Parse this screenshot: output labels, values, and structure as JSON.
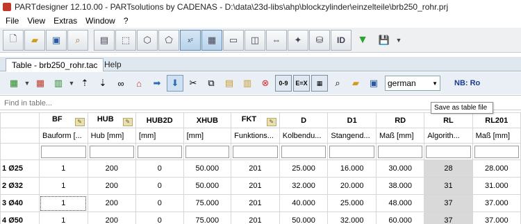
{
  "window": {
    "title": "PARTdesigner 12.10.00 - PARTsolutions by CADENAS - D:\\data\\23d-libs\\ahp\\blockzylinder\\einzelteile\\brb250_rohr.prj"
  },
  "menu": {
    "items": [
      "File",
      "View",
      "Extras",
      "Window",
      "?"
    ]
  },
  "toolbar1": {
    "icons": [
      "new-document-icon",
      "open-folder-icon",
      "save-icon",
      "search-icon",
      "sketch-icon",
      "2d-icon",
      "3d-icon",
      "xyz-icon",
      "table-icon",
      "view-icon",
      "frame-icon",
      "measure-icon",
      "wand-icon",
      "database-icon",
      "id-icon",
      "green-triangle-icon",
      "export-icon"
    ],
    "id_label": "ID"
  },
  "tabs": {
    "active": "Table - brb250_rohr.tac",
    "help": "Help"
  },
  "toolbar2": {
    "language": "german",
    "nb_label": "NB: Ro",
    "range_label": "0-9",
    "equals_label": "E=X"
  },
  "find": {
    "placeholder": "Find in table..."
  },
  "tooltip": {
    "text": "Save as table file"
  },
  "table": {
    "columns": [
      {
        "name": "BF",
        "unit": "Bauform [...",
        "pen": true
      },
      {
        "name": "HUB",
        "unit": "Hub [mm]",
        "pen": true
      },
      {
        "name": "HUB2D",
        "unit": "[mm]",
        "pen": false
      },
      {
        "name": "XHUB",
        "unit": "[mm]",
        "pen": false
      },
      {
        "name": "FKT",
        "unit": "Funktions...",
        "pen": true
      },
      {
        "name": "D",
        "unit": "Kolbendu...",
        "pen": false
      },
      {
        "name": "D1",
        "unit": "Stangend...",
        "pen": false
      },
      {
        "name": "RD",
        "unit": "Maß [mm]",
        "pen": false
      },
      {
        "name": "RL",
        "unit": "Algorith...",
        "pen": false
      },
      {
        "name": "RL201",
        "unit": "Maß [mm]",
        "pen": false
      }
    ],
    "rows": [
      {
        "index": "1",
        "label": "Ø25",
        "values": [
          "1",
          "200",
          "0",
          "50.000",
          "201",
          "25.000",
          "16.000",
          "30.000",
          "28",
          "28.000"
        ]
      },
      {
        "index": "2",
        "label": "Ø32",
        "values": [
          "1",
          "200",
          "0",
          "50.000",
          "201",
          "32.000",
          "20.000",
          "38.000",
          "31",
          "31.000"
        ]
      },
      {
        "index": "3",
        "label": "Ø40",
        "values": [
          "1",
          "200",
          "0",
          "75.000",
          "201",
          "40.000",
          "25.000",
          "48.000",
          "37",
          "37.000"
        ]
      },
      {
        "index": "4",
        "label": "Ø50",
        "values": [
          "1",
          "200",
          "0",
          "75.000",
          "201",
          "50.000",
          "32.000",
          "60.000",
          "37",
          "37.000"
        ]
      }
    ]
  }
}
